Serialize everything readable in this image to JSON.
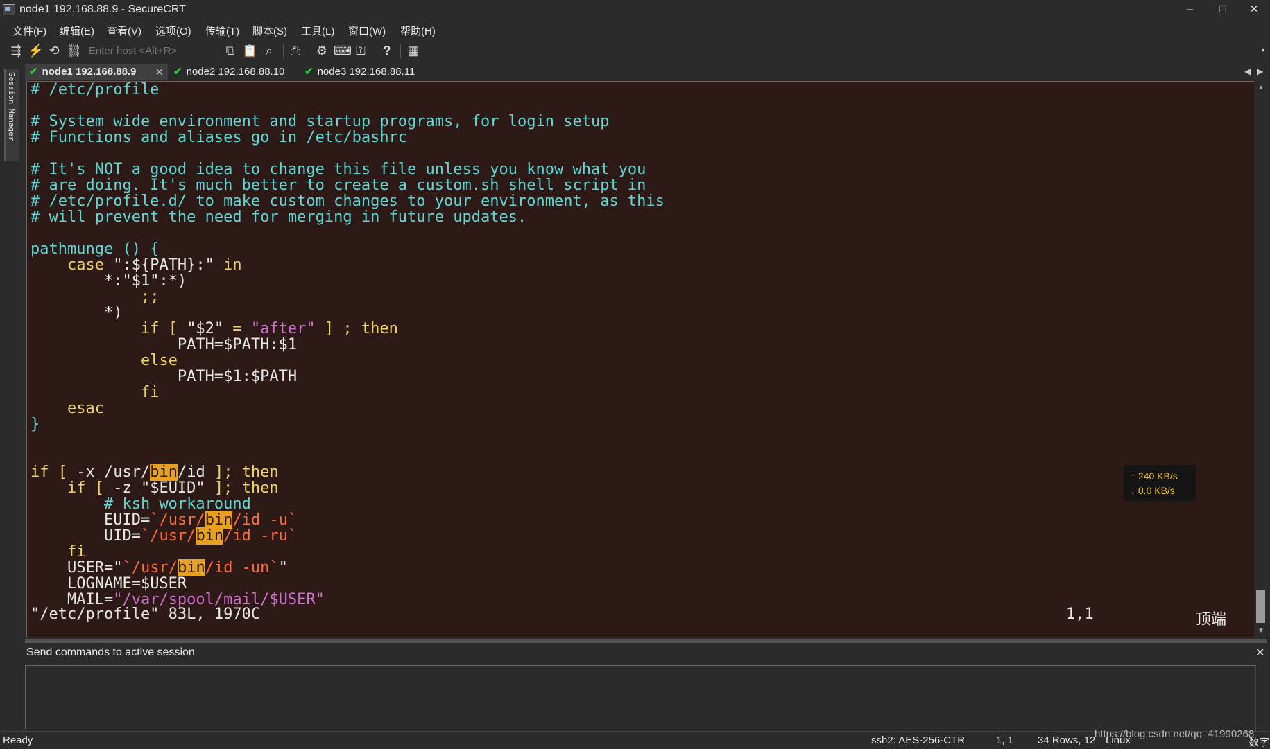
{
  "window": {
    "title": "node1 192.168.88.9 - SecureCRT",
    "minimize": "–",
    "restore": "❐",
    "close": "✕"
  },
  "menu": [
    "文件(F)",
    "编辑(E)",
    "查看(V)",
    "选项(O)",
    "传输(T)",
    "脚本(S)",
    "工具(L)",
    "窗口(W)",
    "帮助(H)"
  ],
  "toolbar": {
    "host_placeholder": "Enter host <Alt+R>",
    "icons": [
      "connect-icon",
      "quick-connect-icon",
      "reconnect-icon",
      "disconnect-icon",
      "copy-icon",
      "paste-icon",
      "find-icon",
      "print-icon",
      "settings-icon",
      "keymap-icon",
      "key-icon",
      "help-icon",
      "sftp-icon"
    ]
  },
  "side_panel": {
    "label": "Session Manager"
  },
  "tabs": [
    {
      "label": "node1 192.168.88.9",
      "active": true
    },
    {
      "label": "node2 192.168.88.10",
      "active": false
    },
    {
      "label": "node3 192.168.88.11",
      "active": false
    }
  ],
  "terminal": {
    "status_file": "\"/etc/profile\" 83L, 1970C",
    "status_pos": "1,1",
    "status_scroll": "顶端"
  },
  "speed": {
    "up": "↑ 240 KB/s",
    "down": "↓ 0.0 KB/s"
  },
  "command_window": {
    "title": "Send commands to active session",
    "close": "✕"
  },
  "statusbar": {
    "ready": "Ready",
    "cipher": "ssh2: AES-256-CTR",
    "cursor": "1,    1",
    "size": "34 Rows, 12",
    "os": "Linux",
    "watermark": "https://blog.csdn.net/qq_41990268",
    "ime": "数字"
  },
  "colors": {
    "terminal_bg": "#2d1a16",
    "comment": "#5fd7d7",
    "keyword": "#f0d36a",
    "string": "#d070d0",
    "command": "#ff6a3d",
    "highlight": "#e8a020",
    "speed_text": "#f0c030"
  }
}
